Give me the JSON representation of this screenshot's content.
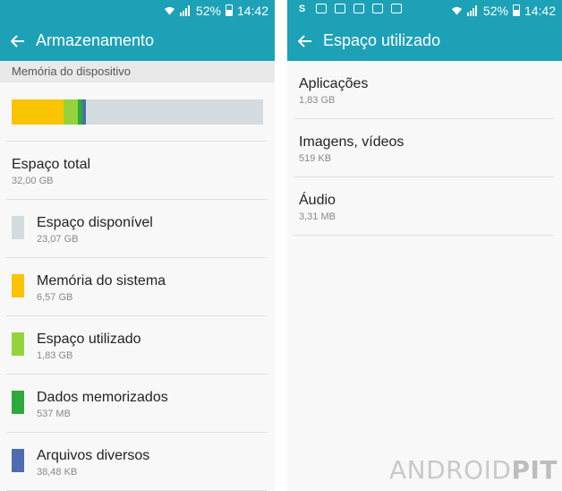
{
  "status": {
    "battery": "52%",
    "time": "14:42"
  },
  "left_screen": {
    "title": "Armazenamento",
    "section_header": "Memória do dispositivo",
    "storage_bar": {
      "total_gb": 32.0,
      "segments": [
        {
          "name": "Memória do sistema",
          "fraction": 0.205,
          "color": "#fbc400"
        },
        {
          "name": "Espaço utilizado",
          "fraction": 0.057,
          "color": "#95d33c"
        },
        {
          "name": "Dados memorizados",
          "fraction": 0.017,
          "color": "#2eaa3d"
        },
        {
          "name": "Arquivos diversos",
          "fraction": 0.015,
          "color": "#4f6cb0"
        }
      ],
      "free_color": "#d5dcdf"
    },
    "total": {
      "title": "Espaço total",
      "value": "32,00 GB"
    },
    "items": [
      {
        "title": "Espaço disponível",
        "value": "23,07 GB",
        "color": "#d5dcdf"
      },
      {
        "title": "Memória do sistema",
        "value": "6,57 GB",
        "color": "#fbc400"
      },
      {
        "title": "Espaço utilizado",
        "value": "1,83 GB",
        "color": "#95d33c"
      },
      {
        "title": "Dados memorizados",
        "value": "537 MB",
        "color": "#2eaa3d"
      },
      {
        "title": "Arquivos diversos",
        "value": "38,48 KB",
        "color": "#4f6cb0"
      }
    ]
  },
  "right_screen": {
    "title": "Espaço utilizado",
    "items": [
      {
        "title": "Aplicações",
        "value": "1,83 GB"
      },
      {
        "title": "Imagens, vídeos",
        "value": "519 KB"
      },
      {
        "title": "Áudio",
        "value": "3,31 MB"
      }
    ]
  },
  "watermark": {
    "part1": "ANDROID",
    "part2": "PIT"
  },
  "colors": {
    "accent": "#1da1b7",
    "background": "#f8f8f8"
  }
}
